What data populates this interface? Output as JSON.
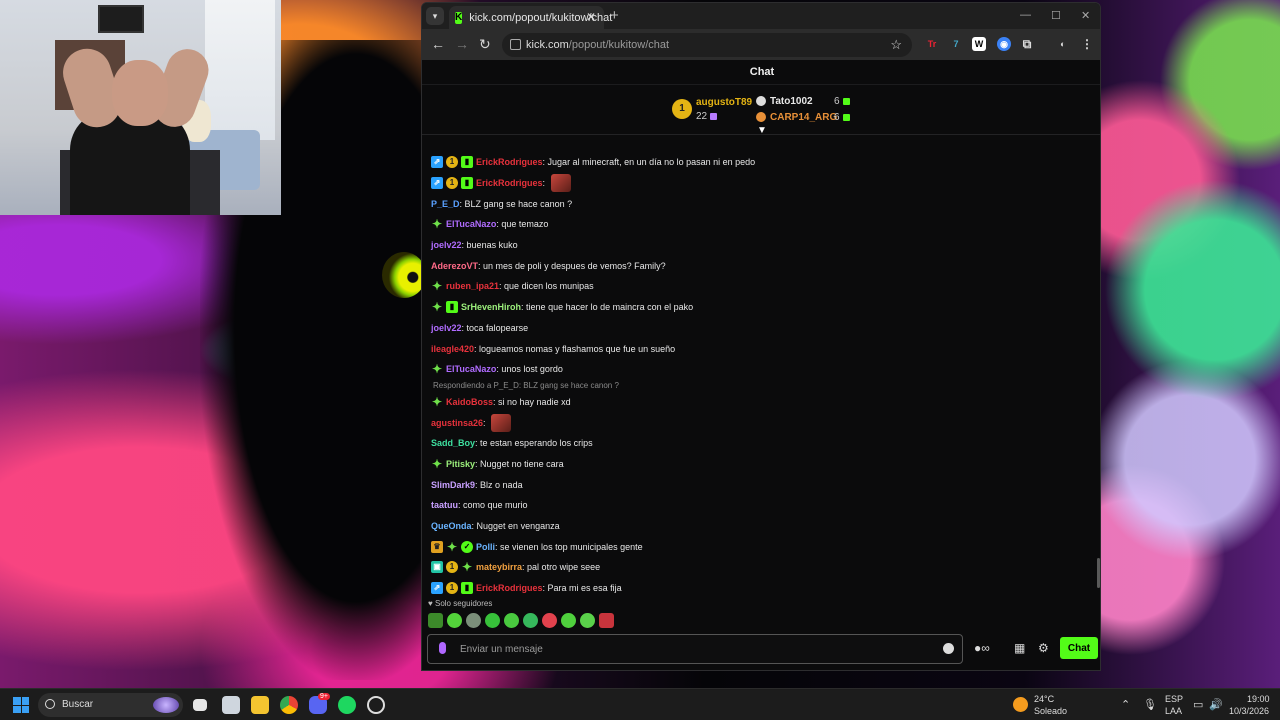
{
  "browser": {
    "tab_title": "kick.com/popout/kukitow/chat",
    "tab_favicon": "K",
    "url_host": "kick.com",
    "url_path": "/popout/kukitow/chat",
    "new_tab_symbol": "+"
  },
  "chat": {
    "header": "Chat",
    "leaderboard": [
      {
        "rank": "1",
        "name": "augustoT89",
        "count": "22",
        "color": "#e4b414"
      },
      {
        "rank": "",
        "name": "Tato1002",
        "count": "6",
        "color": "#e8e8e8"
      },
      {
        "rank": "",
        "name": "CARP14_ARG",
        "count": "6",
        "color": "#e89038"
      }
    ],
    "messages": [
      {
        "badges": [
          "mod",
          "gold",
          "gift"
        ],
        "user": "ErickRodrigues",
        "color": "#e8323c",
        "text": "Jugar al minecraft, en un día no lo pasan ni en pedo"
      },
      {
        "badges": [
          "mod",
          "gold",
          "gift"
        ],
        "user": "ErickRodrigues",
        "color": "#e8323c",
        "text": "",
        "emote": true
      },
      {
        "badges": [],
        "user": "P_E_D",
        "color": "#5aa0ff",
        "text": "BLZ gang se hace canon ?"
      },
      {
        "badges": [
          "spark"
        ],
        "user": "ElTucaNazo",
        "color": "#b06cff",
        "text": "que temazo"
      },
      {
        "badges": [],
        "user": "joelv22",
        "color": "#b06cff",
        "text": "buenas kuko"
      },
      {
        "badges": [],
        "user": "AderezoVT",
        "color": "#ff6a88",
        "text": "un mes de poli y despues de vemos? Family?"
      },
      {
        "badges": [
          "spark"
        ],
        "user": "ruben_ipa21",
        "color": "#e8323c",
        "text": "que dicen los munipas"
      },
      {
        "badges": [
          "spark",
          "gift"
        ],
        "user": "SrHevenHiroh",
        "color": "#9cf07c",
        "text": "tiene que hacer lo de maincra con el pako"
      },
      {
        "badges": [],
        "user": "joelv22",
        "color": "#b06cff",
        "text": "toca falopearse"
      },
      {
        "badges": [],
        "user": "ileagle420",
        "color": "#e8323c",
        "text": "logueamos nomas y flashamos que fue un sueño"
      },
      {
        "badges": [
          "spark"
        ],
        "user": "ElTucaNazo",
        "color": "#b06cff",
        "text": "unos lost gordo"
      },
      {
        "reply": "Respondiendo a P_E_D: BLZ gang se hace canon ?",
        "badges": [
          "spark"
        ],
        "user": "KaidoBoss",
        "color": "#e8323c",
        "text": "si no hay nadie xd"
      },
      {
        "badges": [],
        "user": "agustinsa26",
        "color": "#e8323c",
        "text": "",
        "emote": true
      },
      {
        "badges": [],
        "user": "Sadd_Boy",
        "color": "#3ee0a0",
        "text": "te estan esperando los crips"
      },
      {
        "badges": [
          "spark"
        ],
        "user": "Pitisky",
        "color": "#9cf07c",
        "text": "Nugget no tiene cara"
      },
      {
        "badges": [],
        "user": "SlimDark9",
        "color": "#c8a0ff",
        "text": "Blz o nada"
      },
      {
        "badges": [],
        "user": "taatuu",
        "color": "#c8a0ff",
        "text": "como que murio"
      },
      {
        "badges": [],
        "user": "QueOnda",
        "color": "#6ab4ff",
        "text": "Nugget en venganza"
      },
      {
        "badges": [
          "crown",
          "spark",
          "verif"
        ],
        "user": "Polli",
        "color": "#6ab4ff",
        "text": "se vienen los top municipales gente"
      },
      {
        "badges": [
          "teal",
          "gold",
          "spark"
        ],
        "user": "mateybirra",
        "color": "#f0a040",
        "text": "pal otro wipe seee"
      },
      {
        "badges": [
          "mod",
          "gold",
          "gift"
        ],
        "user": "ErickRodrigues",
        "color": "#e8323c",
        "text": "Para mi es esa fija"
      }
    ],
    "followers_only": "Solo seguidores",
    "input_placeholder": "Enviar un mensaje",
    "send_label": "Chat"
  },
  "taskbar": {
    "search_label": "Buscar",
    "weather_temp": "24°C",
    "weather_desc": "Soleado",
    "lang_top": "ESP",
    "lang_bottom": "LAA",
    "time": "19:00",
    "date": "10/3/2026",
    "discord_badge": "9+"
  }
}
